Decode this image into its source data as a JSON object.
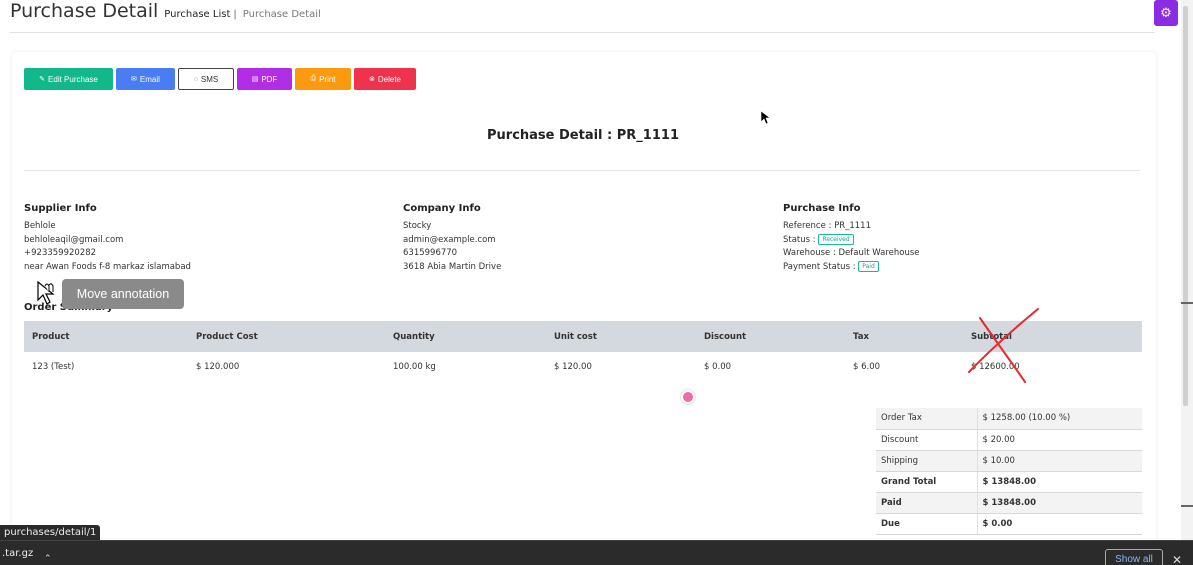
{
  "header": {
    "title": "Purchase Detail",
    "crumb_list": "Purchase List",
    "crumb_sep": "|",
    "crumb_current": "Purchase Detail"
  },
  "settings_icon": "gear-icon",
  "toolbar": [
    {
      "label": "Edit Purchase",
      "icon": "edit-icon",
      "glyph": "✎",
      "color": "#13b88a"
    },
    {
      "label": "Email",
      "icon": "mail-icon",
      "glyph": "✉",
      "color": "#4a7cf4"
    },
    {
      "label": "SMS",
      "icon": "chat-icon",
      "glyph": "💬",
      "color": "#ffffff"
    },
    {
      "label": "PDF",
      "icon": "file-icon",
      "glyph": "▤",
      "color": "#b22ee6"
    },
    {
      "label": "Print",
      "icon": "printer-icon",
      "glyph": "⎙",
      "color": "#fb9a0e"
    },
    {
      "label": "Delete",
      "icon": "delete-icon",
      "glyph": "⊗",
      "color": "#f0334d"
    }
  ],
  "detail_title": "Purchase Detail : PR_1111",
  "supplier": {
    "heading": "Supplier Info",
    "name": "Behlole",
    "email": "behloleaqil@gmail.com",
    "phone": "+923359920282",
    "address": "near Awan Foods f-8 markaz islamabad"
  },
  "company": {
    "heading": "Company Info",
    "name": "Stocky",
    "email": "admin@example.com",
    "phone": "6315996770",
    "address": "3618 Abia Martin Drive"
  },
  "purchase": {
    "heading": "Purchase Info",
    "reference": "Reference : PR_1111",
    "status_label": "Status :",
    "status_badge": "Received",
    "warehouse": "Warehouse : Default Warehouse",
    "payment_label": "Payment Status :",
    "payment_badge": "Paid",
    "badge_color": "#14a58c"
  },
  "order_summary": {
    "heading": "Order Summary",
    "columns": [
      "Product",
      "Product Cost",
      "Quantity",
      "Unit cost",
      "Discount",
      "Tax",
      "Subtotal"
    ],
    "rows": [
      [
        "123 (Test)",
        "$ 120.000",
        "100.00 kg",
        "$ 120.00",
        "$ 0.00",
        "$ 6.00",
        "$ 12600.00"
      ]
    ]
  },
  "totals": [
    {
      "label": "Order Tax",
      "value": "$ 1258.00 (10.00 %)",
      "bold": false
    },
    {
      "label": "Discount",
      "value": "$ 20.00",
      "bold": false
    },
    {
      "label": "Shipping",
      "value": "$ 10.00",
      "bold": false
    },
    {
      "label": "Grand Total",
      "value": "$ 13848.00",
      "bold": true
    },
    {
      "label": "Paid",
      "value": "$ 13848.00",
      "bold": true
    },
    {
      "label": "Due",
      "value": "$ 0.00",
      "bold": true
    }
  ],
  "annotation_tooltip": "Move annotation",
  "status_url": "purchases/detail/1",
  "download_bar": {
    "file": ".tar.gz",
    "show_all": "Show all"
  }
}
